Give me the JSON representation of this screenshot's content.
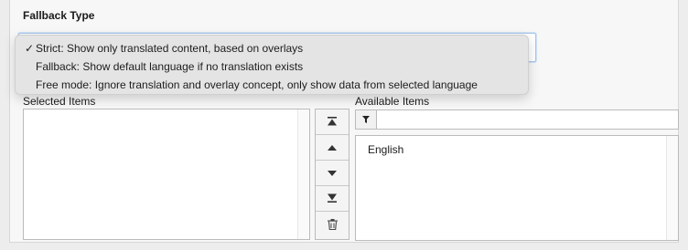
{
  "field": {
    "title": "Fallback Type"
  },
  "dropdown": {
    "options": [
      {
        "label": "Strict: Show only translated content, based on overlays",
        "checked": true,
        "check_mark": "✓"
      },
      {
        "label": "Fallback: Show default language if no translation exists",
        "checked": false
      },
      {
        "label": "Free mode: Ignore translation and overlay concept, only show data from selected language",
        "checked": false
      }
    ]
  },
  "selected": {
    "label": "Selected Items",
    "items": []
  },
  "available": {
    "label": "Available Items",
    "filter_value": "",
    "filter_icon": "filter-icon",
    "items": [
      "English"
    ]
  },
  "buttons": [
    {
      "icon": "move-to-top-icon"
    },
    {
      "icon": "move-up-icon"
    },
    {
      "icon": "move-down-icon"
    },
    {
      "icon": "move-to-bottom-icon"
    },
    {
      "icon": "trash-icon"
    }
  ],
  "colors": {
    "focus_border": "#a9c8ec",
    "dropdown_bg": "#e4e4e4",
    "panel_bg": "#f7f7f7"
  }
}
